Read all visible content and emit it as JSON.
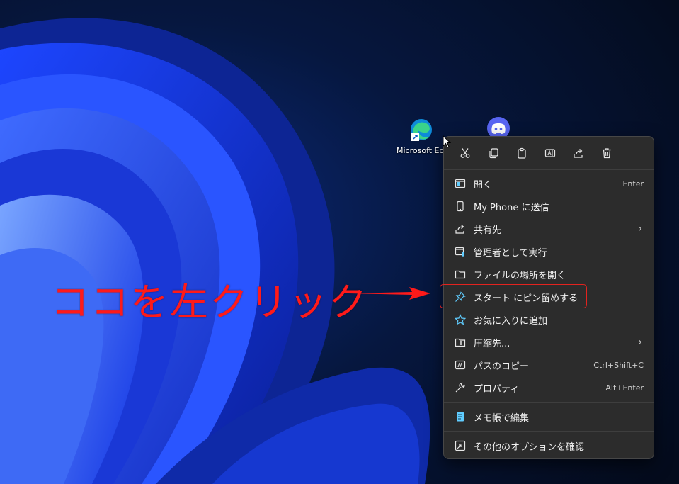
{
  "desktop": {
    "icons": [
      {
        "label": "Microsoft Edge",
        "icon": "edge-icon"
      },
      {
        "label": "",
        "icon": "discord-icon"
      }
    ]
  },
  "annotation": {
    "text": "ココを左クリック",
    "color": "#ff1a1a"
  },
  "context_menu": {
    "quick_actions": [
      {
        "name": "cut",
        "icon": "scissors-icon"
      },
      {
        "name": "copy",
        "icon": "copy-icon"
      },
      {
        "name": "paste",
        "icon": "clipboard-icon"
      },
      {
        "name": "rename",
        "icon": "rename-icon"
      },
      {
        "name": "share",
        "icon": "share-icon"
      },
      {
        "name": "delete",
        "icon": "trash-icon"
      }
    ],
    "items": [
      {
        "label": "開く",
        "shortcut": "Enter",
        "icon": "open-window-icon"
      },
      {
        "label": "My Phone に送信",
        "shortcut": "",
        "icon": "phone-icon"
      },
      {
        "label": "共有先",
        "shortcut": "",
        "icon": "share-icon",
        "submenu": true
      },
      {
        "label": "管理者として実行",
        "shortcut": "",
        "icon": "admin-shield-icon"
      },
      {
        "label": "ファイルの場所を開く",
        "shortcut": "",
        "icon": "folder-icon"
      },
      {
        "label": "スタート にピン留めする",
        "shortcut": "",
        "icon": "pin-icon",
        "highlighted": true
      },
      {
        "label": "お気に入りに追加",
        "shortcut": "",
        "icon": "star-icon"
      },
      {
        "label": "圧縮先...",
        "shortcut": "",
        "icon": "zip-folder-icon",
        "submenu": true
      },
      {
        "label": "パスのコピー",
        "shortcut": "Ctrl+Shift+C",
        "icon": "path-copy-icon"
      },
      {
        "label": "プロパティ",
        "shortcut": "Alt+Enter",
        "icon": "wrench-icon"
      },
      {
        "label": "メモ帳で編集",
        "shortcut": "",
        "icon": "notepad-icon"
      },
      {
        "label": "その他のオプションを確認",
        "shortcut": "",
        "icon": "more-options-icon"
      }
    ],
    "submenu_glyph": "›"
  },
  "colors": {
    "menu_bg": "#2c2c2c",
    "accent_icon": "#60cdff",
    "highlight_border": "#e3231f"
  }
}
